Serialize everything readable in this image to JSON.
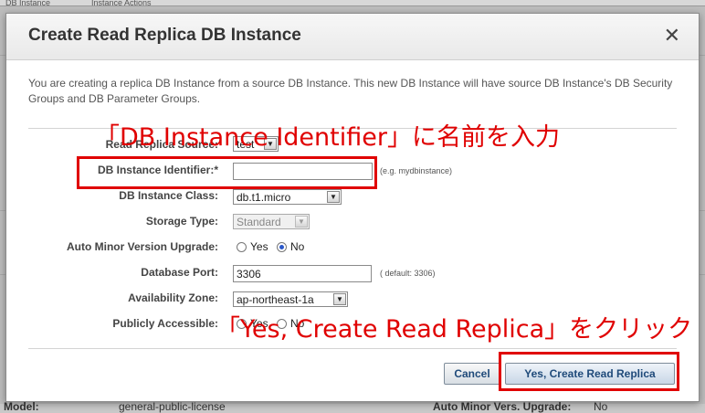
{
  "background": {
    "tabs": [
      "DB Instance",
      "Instance Actions"
    ],
    "footer_left_label": "Model:",
    "footer_left_value": "general-public-license",
    "footer_right_label": "Auto Minor Vers. Upgrade:",
    "footer_right_value": "No"
  },
  "dialog": {
    "title": "Create Read Replica DB Instance",
    "close_glyph": "✕",
    "description": "You are creating a replica DB Instance from a source DB Instance. This new DB Instance will have source DB Instance's DB Security Groups and DB Parameter Groups."
  },
  "form": {
    "source": {
      "label": "Read Replica Source:",
      "value": "test"
    },
    "identifier": {
      "label": "DB Instance Identifier:*",
      "value": "",
      "hint": "(e.g. mydbinstance)"
    },
    "instance_class": {
      "label": "DB Instance Class:",
      "value": "db.t1.micro"
    },
    "storage_type": {
      "label": "Storage Type:",
      "value": "Standard"
    },
    "auto_minor": {
      "label": "Auto Minor Version Upgrade:",
      "yes": "Yes",
      "no": "No",
      "selected": "No"
    },
    "port": {
      "label": "Database Port:",
      "value": "3306",
      "hint": "( default: 3306)"
    },
    "az": {
      "label": "Availability Zone:",
      "value": "ap-northeast-1a"
    },
    "publicly_accessible": {
      "label": "Publicly Accessible:",
      "yes": "Yes",
      "no": "No"
    }
  },
  "buttons": {
    "cancel": "Cancel",
    "create": "Yes, Create Read Replica"
  },
  "annotations": {
    "identifier_note": "「DB Instance Identifier」に名前を入力",
    "create_note": "「Yes, Create Read Replica」をクリック",
    "color": "#e00000"
  },
  "colors": {
    "accent_text": "#1f4a7a",
    "annotation": "#e00000"
  }
}
